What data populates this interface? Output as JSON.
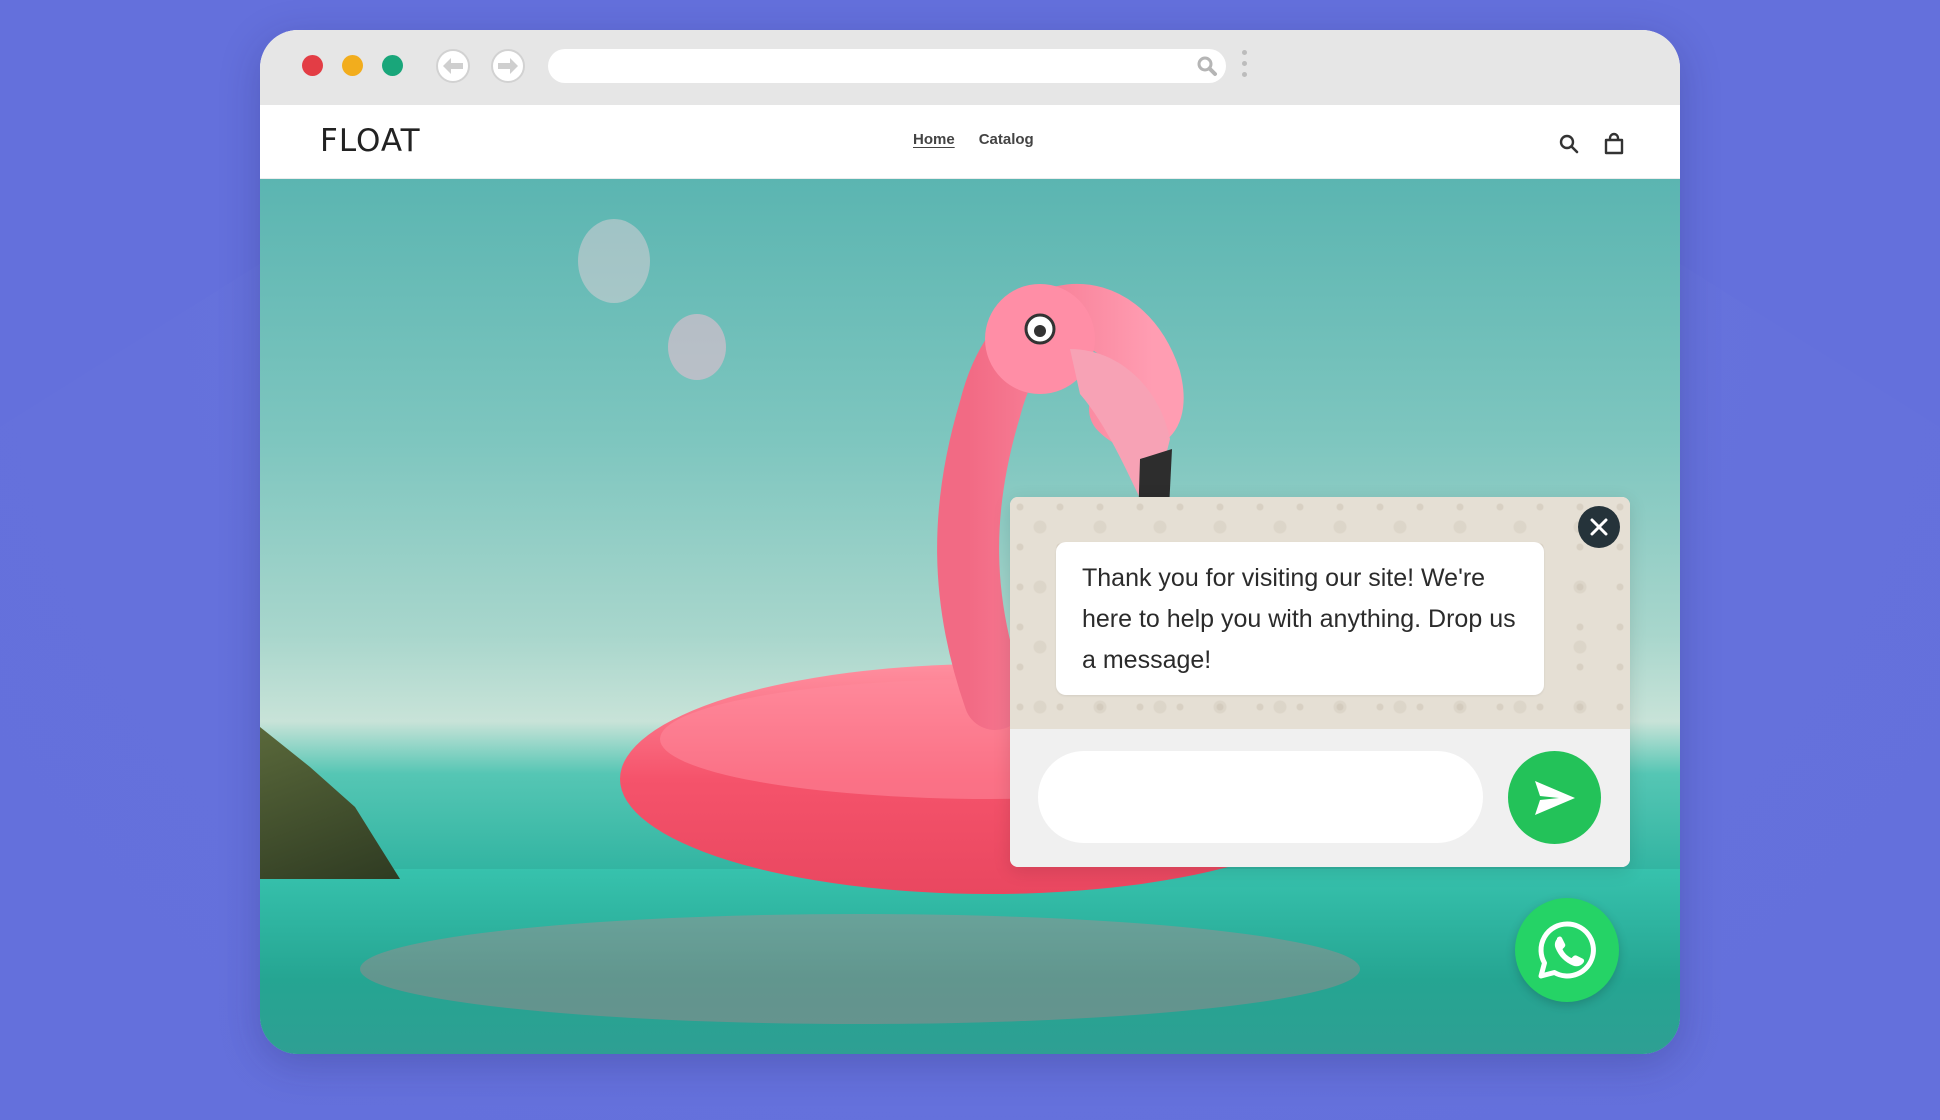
{
  "browser": {
    "window_controls": [
      {
        "name": "close",
        "color": "#e33d45"
      },
      {
        "name": "minimize",
        "color": "#f2ad1d"
      },
      {
        "name": "zoom",
        "color": "#19a67a"
      }
    ],
    "address": {
      "value": "",
      "placeholder": ""
    },
    "icons": {
      "back": "arrow-left-icon",
      "forward": "arrow-right-icon",
      "search": "search-icon",
      "menu": "vertical-dots-icon"
    }
  },
  "site": {
    "logo": "FLOAT",
    "nav": [
      {
        "label": "Home",
        "active": true
      },
      {
        "label": "Catalog",
        "active": false
      }
    ],
    "header_icons": [
      "search-icon",
      "shopping-bag-icon"
    ]
  },
  "chat": {
    "message": "Thank you for visiting our site! We're here to help you with anything. Drop us a message!",
    "input": {
      "value": "",
      "placeholder": ""
    },
    "colors": {
      "send": "#23c259",
      "close": "#25333a",
      "whatsapp": "#25d366"
    },
    "icons": {
      "close": "close-icon",
      "send": "send-icon",
      "launcher": "whatsapp-icon"
    }
  }
}
